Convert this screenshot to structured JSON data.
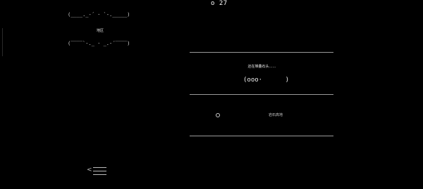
{
  "header": {
    "counter_icon": "circle-outline-icon",
    "counter_value": "o 27"
  },
  "map": {
    "frame_top": "(____._-´ · `-._____)",
    "title": "地区",
    "frame_bottom": "(‾‾‾‾`-._ · _.-´‾‾‾‾)"
  },
  "status": {
    "message": "还在堆叠石头……",
    "progress": "(ooo·      )"
  },
  "list": {
    "items": [
      {
        "marker_icon": "circle-outline-icon",
        "label": "岩石高地"
      }
    ]
  },
  "nav": {
    "back_icon": "chevron-left-icon",
    "menu_icon": "hamburger-menu-icon"
  }
}
